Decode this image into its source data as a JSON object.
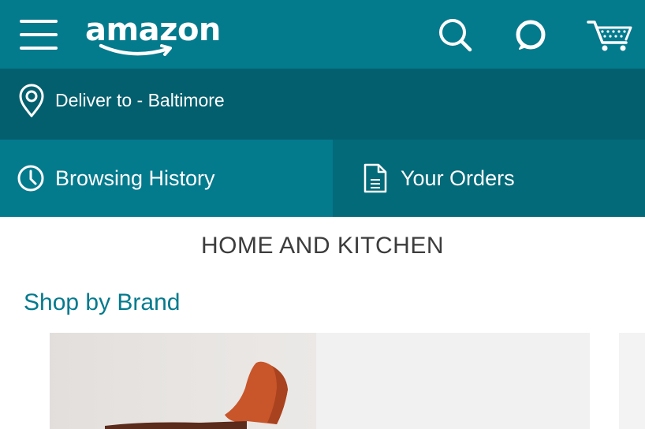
{
  "header": {
    "logo_text": "amazon",
    "brand_color": "#047a8d",
    "icons": [
      "menu-icon",
      "search-icon",
      "alexa-icon",
      "cart-icon"
    ]
  },
  "delivery": {
    "label": "Deliver to - Baltimore",
    "icon": "location-pin-icon"
  },
  "tabs": [
    {
      "label": "Browsing History",
      "icon": "clock-icon"
    },
    {
      "label": "Your Orders",
      "icon": "document-icon"
    }
  ],
  "main": {
    "category_title": "HOME AND KITCHEN",
    "shop_by_brand": "Shop by Brand"
  }
}
